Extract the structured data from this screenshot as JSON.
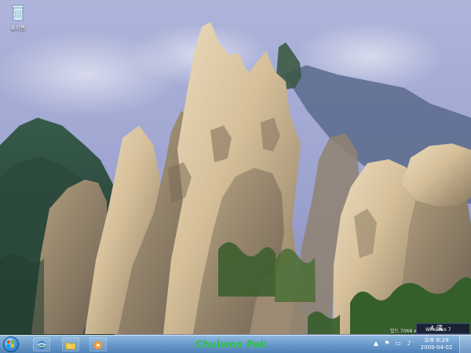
{
  "desktop": {
    "recycle_bin_label": "휴지통"
  },
  "overlay": {
    "build_text": "빌드 7068 w",
    "os_label": "Windows 7"
  },
  "taskbar": {
    "center_text": "Chulwoo Pak",
    "tray_ampm_time": "오후 8:29",
    "tray_date": "2009-04-02",
    "ime_text": "A 漢"
  },
  "colors": {
    "sky_top": "#6c6fae",
    "sky_mid": "#a5a8d8",
    "rock_light": "#d9c7a1",
    "rock_shadow": "#8f7d63",
    "foliage": "#3d6b35",
    "taskbar": "#6d9dcc",
    "center_text": "#2bc53e"
  }
}
